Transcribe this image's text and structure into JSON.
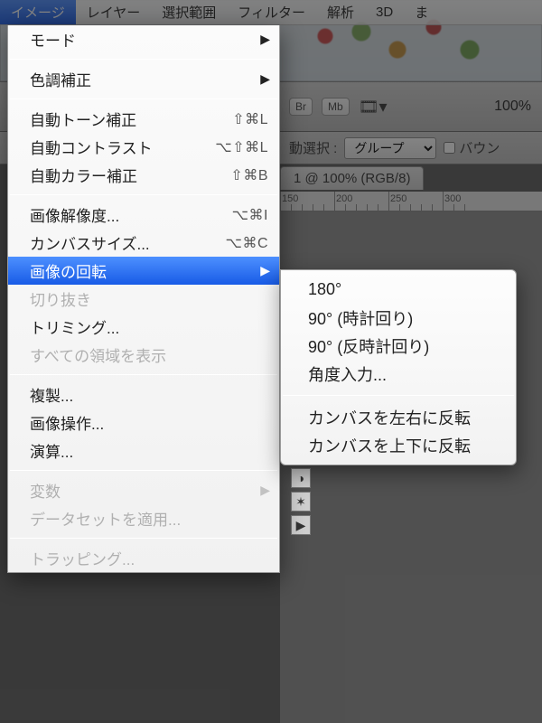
{
  "menubar": {
    "items": [
      {
        "label": "イメージ",
        "active": true
      },
      {
        "label": "レイヤー",
        "active": false
      },
      {
        "label": "選択範囲",
        "active": false
      },
      {
        "label": "フィルター",
        "active": false
      },
      {
        "label": "解析",
        "active": false
      },
      {
        "label": "3D",
        "active": false
      },
      {
        "label": "ま",
        "active": false
      }
    ]
  },
  "toolbar": {
    "chips": [
      "Br",
      "Mb"
    ],
    "zoom_label": "100%"
  },
  "optbar": {
    "auto_select_label": "動選択 :",
    "group_label": "グループ",
    "bounce_label": "バウン"
  },
  "doc": {
    "tab_title": "1 @ 100% (RGB/8)"
  },
  "ruler": {
    "marks": [
      150,
      200,
      250,
      300
    ]
  },
  "menu": {
    "items": [
      {
        "label": "モード",
        "submenu": true
      },
      {
        "sep": true
      },
      {
        "label": "色調補正",
        "submenu": true
      },
      {
        "sep": true
      },
      {
        "label": "自動トーン補正",
        "shortcut": "⇧⌘L"
      },
      {
        "label": "自動コントラスト",
        "shortcut": "⌥⇧⌘L"
      },
      {
        "label": "自動カラー補正",
        "shortcut": "⇧⌘B"
      },
      {
        "sep": true
      },
      {
        "label": "画像解像度...",
        "shortcut": "⌥⌘I"
      },
      {
        "label": "カンバスサイズ...",
        "shortcut": "⌥⌘C"
      },
      {
        "label": "画像の回転",
        "submenu": true,
        "highlight": true
      },
      {
        "label": "切り抜き",
        "disabled": true
      },
      {
        "label": "トリミング..."
      },
      {
        "label": "すべての領域を表示",
        "disabled": true
      },
      {
        "sep": true
      },
      {
        "label": "複製..."
      },
      {
        "label": "画像操作..."
      },
      {
        "label": "演算..."
      },
      {
        "sep": true
      },
      {
        "label": "変数",
        "submenu": true,
        "disabled": true
      },
      {
        "label": "データセットを適用...",
        "disabled": true
      },
      {
        "sep": true
      },
      {
        "label": "トラッピング...",
        "disabled": true
      }
    ]
  },
  "submenu": {
    "items": [
      {
        "label": "180°"
      },
      {
        "label": "90° (時計回り)"
      },
      {
        "label": "90° (反時計回り)"
      },
      {
        "label": "角度入力..."
      },
      {
        "sep": true
      },
      {
        "label": "カンバスを左右に反転"
      },
      {
        "label": "カンバスを上下に反転"
      }
    ]
  },
  "palette_icons": [
    "✎",
    "◑",
    "✶",
    "▶"
  ]
}
